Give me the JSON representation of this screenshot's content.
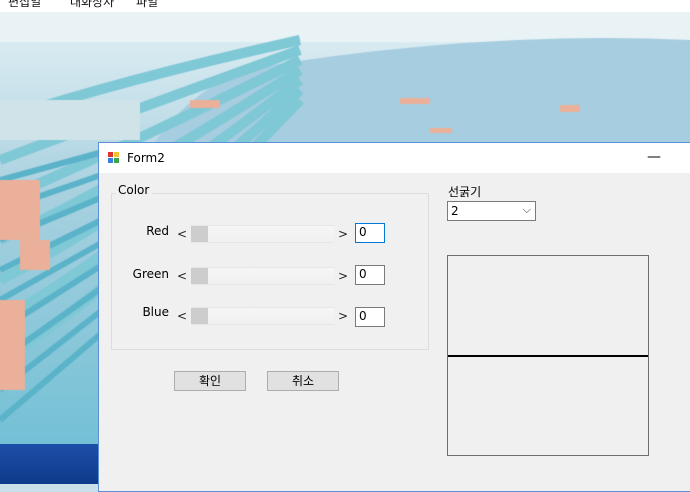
{
  "background": {
    "menu_items": [
      "편집일",
      "대화상자",
      "파일"
    ]
  },
  "window": {
    "title": "Form2",
    "minimize_glyph": "—",
    "color_group": {
      "label": "Color",
      "rows": [
        {
          "label": "Red",
          "value": "0",
          "level": 0
        },
        {
          "label": "Green",
          "value": "0",
          "level": 0
        },
        {
          "label": "Blue",
          "value": "0",
          "level": 0
        }
      ],
      "arrow_left": "<",
      "arrow_right": ">"
    },
    "line_width": {
      "label": "선굵기",
      "selected": "2",
      "chevron": "⌵"
    },
    "buttons": {
      "ok": "확인",
      "cancel": "취소"
    }
  }
}
